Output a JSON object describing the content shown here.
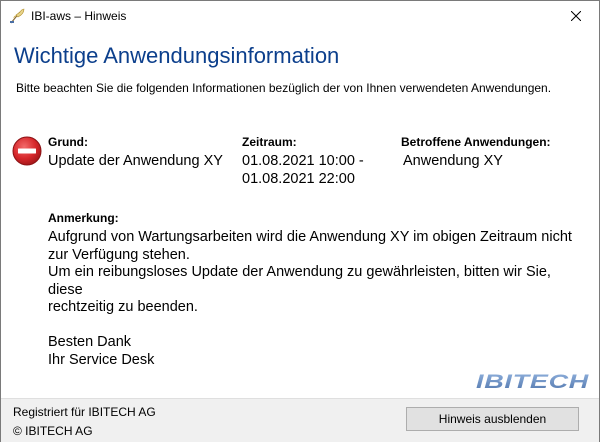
{
  "window": {
    "title": "IBI-aws – Hinweis",
    "icons": {
      "app": "feather-quill-icon",
      "close": "close-icon"
    }
  },
  "header": {
    "title": "Wichtige Anwendungsinformation",
    "subtitle": "Bitte beachten Sie die folgenden Informationen bezüglich der von Ihnen verwendeten Anwendungen."
  },
  "info": {
    "status_icon": "stop-icon",
    "status_color": "#d6262a",
    "grund_label": "Grund:",
    "grund_value": "Update der Anwendung XY",
    "zeitraum_label": "Zeitraum:",
    "zeitraum_start": "01.08.2021 10:00 -",
    "zeitraum_end": "01.08.2021 22:00",
    "betroffen_label": "Betroffene Anwendungen:",
    "betroffen_value": "Anwendung XY"
  },
  "note": {
    "label": "Anmerkung:",
    "line1": "Aufgrund von Wartungsarbeiten wird die Anwendung XY im obigen Zeitraum nicht",
    "line2": "zur Verfügung stehen.",
    "line3": "Um ein reibungsloses Update der Anwendung zu gewährleisten, bitten wir Sie, diese",
    "line4": "rechtzeitig zu beenden.",
    "line5": "Besten Dank",
    "line6": "Ihr Service Desk"
  },
  "logo": {
    "text": "IBITECH",
    "color": "#5b7fb5"
  },
  "footer": {
    "registered": "Registriert für IBITECH AG",
    "copyright": "© IBITECH AG",
    "hide_button": "Hinweis ausblenden"
  },
  "colors": {
    "heading": "#0c3f8c",
    "footer_bg": "#f0f0f0",
    "button_bg": "#e1e1e1"
  }
}
